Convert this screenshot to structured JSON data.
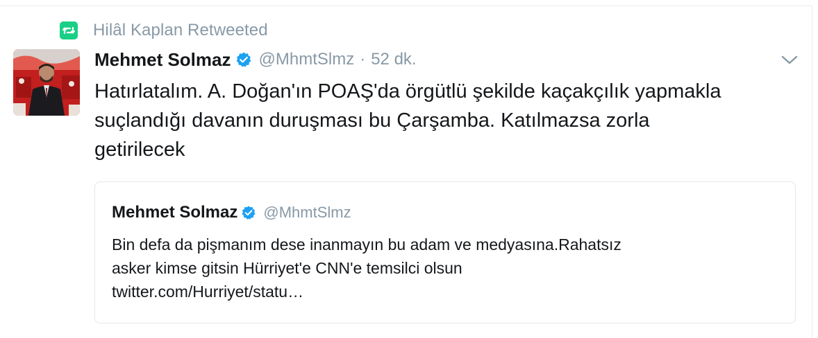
{
  "retweet": {
    "icon": "retweet-icon",
    "icon_color": "#19cf86",
    "label": "Hilâl Kaplan Retweeted"
  },
  "tweet": {
    "avatar_icon": "user-avatar",
    "author_name": "Mehmet Solmaz",
    "verified_icon": "verified-badge-icon",
    "verified_color": "#1da1f2",
    "handle": "@MhmtSlmz",
    "separator": "·",
    "time": "52 dk.",
    "caret_icon": "chevron-down-icon",
    "text": "Hatırlatalım. A. Doğan'ın POAŞ'da örgütlü şekilde kaçakçılık yapmakla\nsuçlandığı davanın duruşması bu Çarşamba. Katılmazsa zorla\ngetirilecek"
  },
  "quoted_tweet": {
    "author_name": "Mehmet Solmaz",
    "verified_icon": "verified-badge-icon",
    "handle": "@MhmtSlmz",
    "text": "Bin defa da pişmanım dese inanmayın bu adam ve medyasına.Rahatsız\nasker kimse gitsin Hürriyet'e CNN'e temsilci olsun\ntwitter.com/Hurriyet/statu…"
  },
  "colors": {
    "text_primary": "#14171a",
    "text_secondary": "#8899a6",
    "border": "#e1e8ed"
  }
}
